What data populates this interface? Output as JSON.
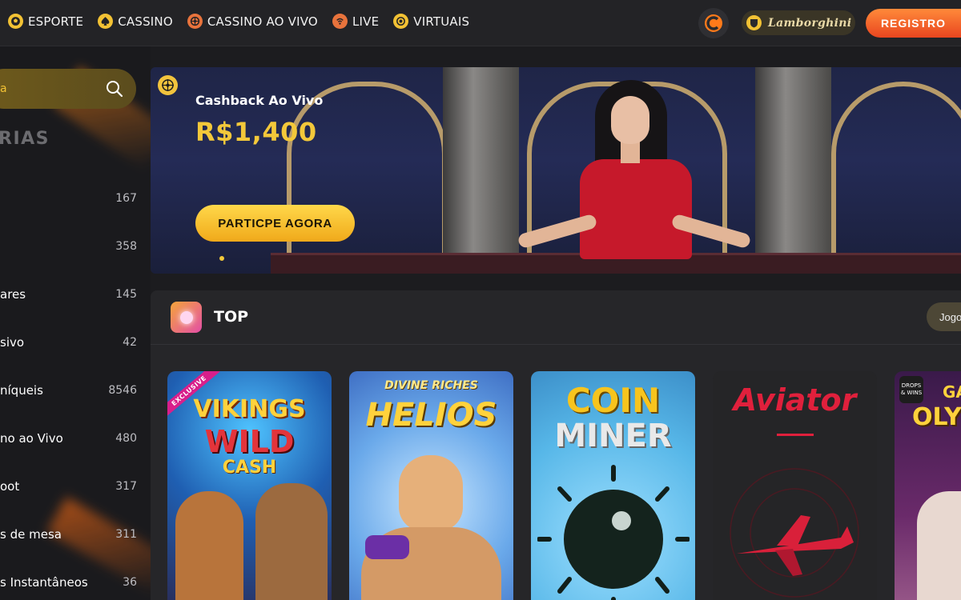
{
  "nav": {
    "items": [
      {
        "label": "ESPORTE",
        "icon": "soccer-ball-icon"
      },
      {
        "label": "CASSINO",
        "icon": "spade-icon"
      },
      {
        "label": "CASSINO AO VIVO",
        "icon": "roulette-icon"
      },
      {
        "label": "LIVE",
        "icon": "live-signal-icon"
      },
      {
        "label": "VIRTUAIS",
        "icon": "virtual-icon"
      }
    ],
    "sponsor": "Lamborghini",
    "register_label": "REGISTRO"
  },
  "sidebar": {
    "search_value": "a",
    "categories_title": "RIAS",
    "categories": [
      {
        "name": "",
        "count": "167"
      },
      {
        "name": "",
        "count": "358"
      },
      {
        "name": "ares",
        "count": "145"
      },
      {
        "name": "sivo",
        "count": "42"
      },
      {
        "name": "níqueis",
        "count": "8546"
      },
      {
        "name": "no ao Vivo",
        "count": "480"
      },
      {
        "name": "oot",
        "count": "317"
      },
      {
        "name": "s de mesa",
        "count": "311"
      },
      {
        "name": "s Instantâneos",
        "count": "36"
      }
    ]
  },
  "banner": {
    "subtitle": "Cashback Ao Vivo",
    "amount": "R$1,400",
    "cta_label": "PARTICPE AGORA"
  },
  "top_games": {
    "title": "TOP",
    "more_label": "Jogo",
    "games": [
      {
        "line1": "VIKINGS",
        "line2": "WILD",
        "line3": "CASH",
        "tag": "EXCLUSIVE"
      },
      {
        "line1": "DIVINE RICHES",
        "line2": "HELIOS",
        "line3": ""
      },
      {
        "line1": "COIN",
        "line2": "MINER",
        "line3": ""
      },
      {
        "line1": "Aviator",
        "line2": "",
        "line3": ""
      },
      {
        "line1": "GA",
        "line2": "OLY",
        "line3": "",
        "tag": "DROPS & WINS"
      }
    ]
  },
  "colors": {
    "accent_yellow": "#f3c83a",
    "register_orange": "#f0622a",
    "background": "#1c1c1f"
  }
}
